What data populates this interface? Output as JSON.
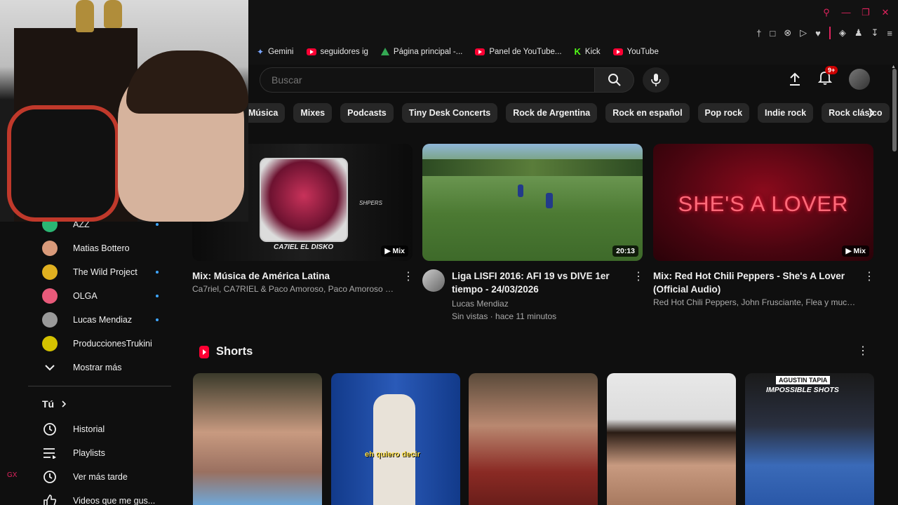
{
  "browser": {
    "bookmarks": [
      {
        "label": "Gemini",
        "icon": "gemini-icon"
      },
      {
        "label": "seguidores ig",
        "icon": "youtube-icon"
      },
      {
        "label": "Página principal -...",
        "icon": "drive-icon"
      },
      {
        "label": "Panel de YouTube...",
        "icon": "youtube-icon"
      },
      {
        "label": "Kick",
        "icon": "kick-icon"
      },
      {
        "label": "YouTube",
        "icon": "youtube-icon"
      }
    ],
    "accent": "#e0245e",
    "side_label": "GX"
  },
  "header": {
    "search_placeholder": "Buscar",
    "notif_count": "9+"
  },
  "chips": [
    "Música",
    "Mixes",
    "Podcasts",
    "Tiny Desk Concerts",
    "Rock de Argentina",
    "Rock en español",
    "Pop rock",
    "Indie rock",
    "Rock clásico"
  ],
  "sidebar": {
    "subscriptions": [
      {
        "label": "AZZ",
        "dot": true,
        "color": "#2bb673"
      },
      {
        "label": "Matias Bottero",
        "dot": false,
        "color": "#d99a7a"
      },
      {
        "label": "The Wild Project",
        "dot": true,
        "color": "#e0b020"
      },
      {
        "label": "OLGA",
        "dot": true,
        "color": "#e85a7a"
      },
      {
        "label": "Lucas Mendiaz",
        "dot": true,
        "color": "#9a9a9a"
      },
      {
        "label": "ProduccionesTrukini",
        "dot": false,
        "color": "#d4c200"
      }
    ],
    "show_more": "Mostrar más",
    "you_header": "Tú",
    "you_items": [
      {
        "label": "Historial",
        "icon": "history-icon"
      },
      {
        "label": "Playlists",
        "icon": "playlists-icon"
      },
      {
        "label": "Ver más tarde",
        "icon": "watch-later-icon"
      },
      {
        "label": "Videos que me gus...",
        "icon": "liked-videos-icon"
      }
    ]
  },
  "videos": [
    {
      "title": "Mix: Música de América Latina",
      "subtitle": "Ca7riel, CA7RIEL & Paco Amoroso, Paco Amoroso y m...",
      "badge": "Mix",
      "thumb_text_left": "CA7IEL EL DISKO",
      "thumb_text_right": "SHPERS"
    },
    {
      "title": "Liga LISFI 2016: AFI 19 vs DIVE 1er tiempo - 24/03/2026",
      "subtitle": "Lucas Mendiaz",
      "stats": "Sin vistas · hace 11 minutos",
      "badge": "20:13"
    },
    {
      "title": "Mix: Red Hot Chili Peppers - She's A Lover (Official Audio)",
      "subtitle": "Red Hot Chili Peppers, John Frusciante, Flea y muchos ...",
      "badge": "Mix",
      "thumb_text": "SHE'S A LOVER"
    }
  ],
  "shorts": {
    "title": "Shorts",
    "items": [
      {
        "caption": ""
      },
      {
        "caption": "eh quiero decir"
      },
      {
        "caption": ""
      },
      {
        "caption": ""
      },
      {
        "caption": "IMPOSSIBLE SHOTS",
        "top": "AGUSTIN TAPIA"
      }
    ]
  }
}
